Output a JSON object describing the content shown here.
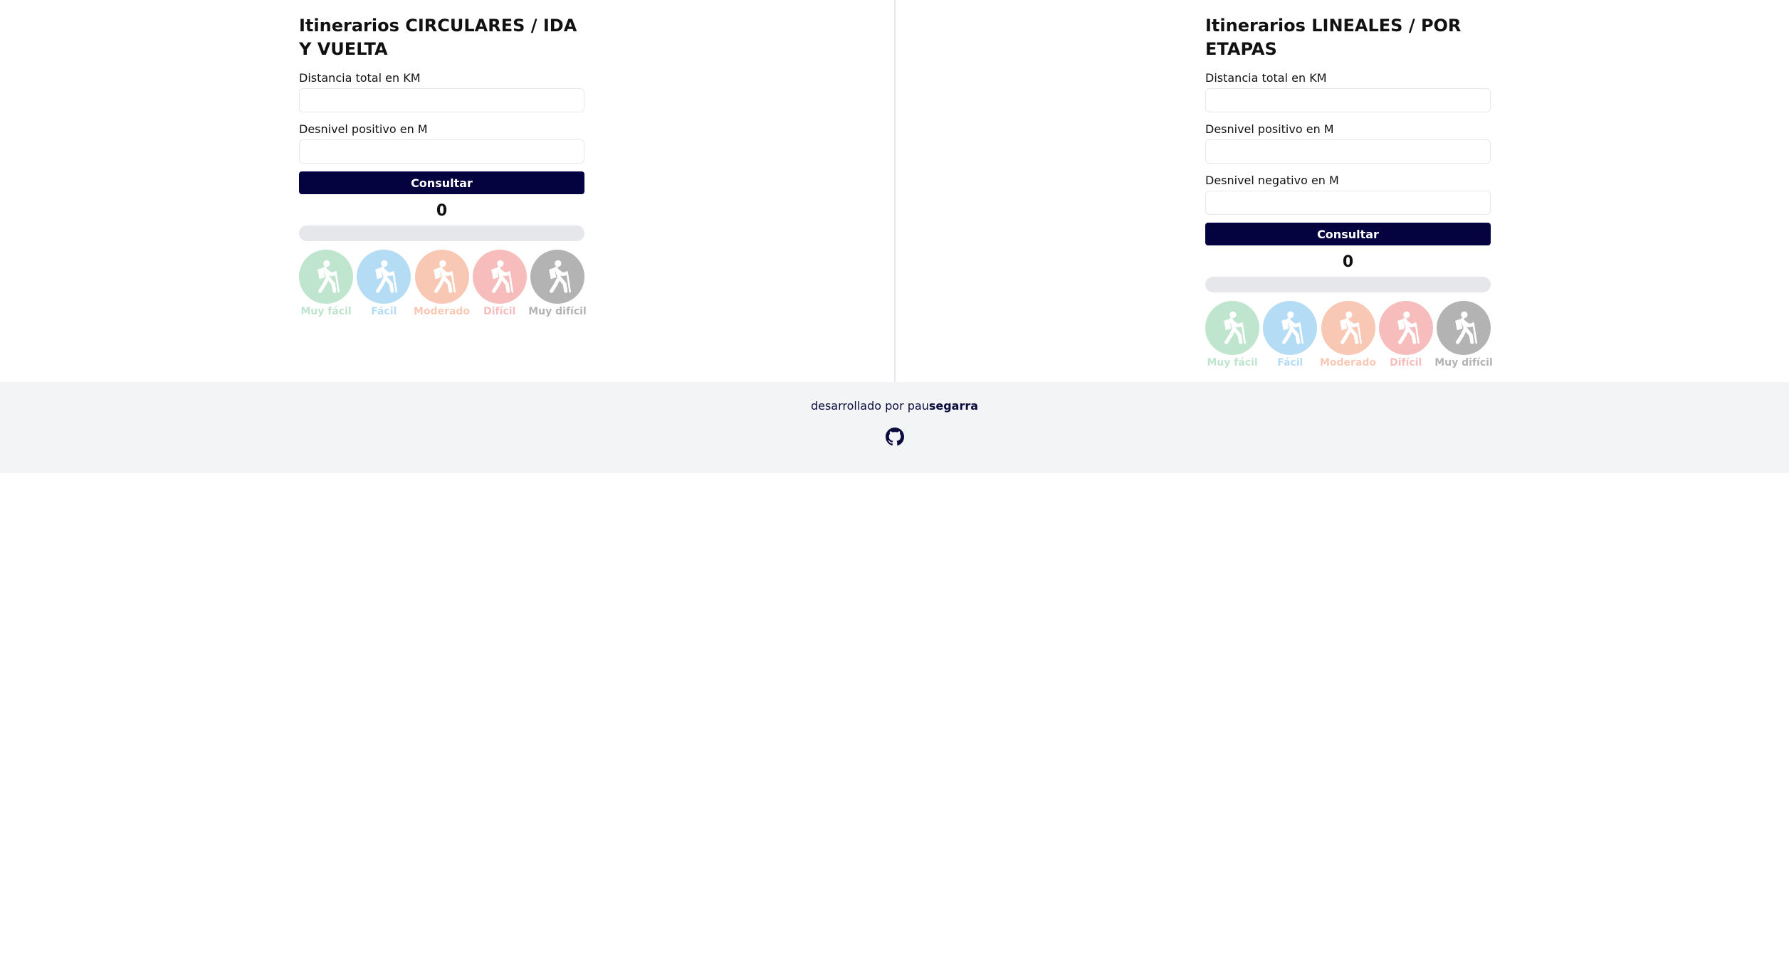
{
  "theme": {
    "primary": "#05033f",
    "primary_text": "#ffffff",
    "text": "#111111",
    "border": "#e5e7eb",
    "track": "#e5e7eb",
    "footer_bg": "#f3f4f6"
  },
  "difficulty_levels": [
    {
      "label": "Muy fácil",
      "icon": "hiker-icon",
      "color": "#bfe5cf"
    },
    {
      "label": "Fácil",
      "icon": "hiker-icon",
      "color": "#b5dcf5"
    },
    {
      "label": "Moderado",
      "icon": "hiker-icon",
      "color": "#f9c8b4"
    },
    {
      "label": "Difícil",
      "icon": "hiker-icon",
      "color": "#f7bcbc"
    },
    {
      "label": "Muy difícil",
      "icon": "hiker-icon",
      "color": "#b3b3b3"
    }
  ],
  "circular": {
    "title": "Itinerarios CIRCULARES / IDA Y VUELTA",
    "fields": [
      {
        "label": "Distancia total en KM",
        "value": "",
        "placeholder": ""
      },
      {
        "label": "Desnivel positivo en M",
        "value": "",
        "placeholder": ""
      }
    ],
    "submit_label": "Consultar",
    "score": "0",
    "progress": 0
  },
  "linear": {
    "title": "Itinerarios LINEALES / POR ETAPAS",
    "fields": [
      {
        "label": "Distancia total en KM",
        "value": "",
        "placeholder": ""
      },
      {
        "label": "Desnivel positivo en M",
        "value": "",
        "placeholder": ""
      },
      {
        "label": "Desnivel negativo en M",
        "value": "",
        "placeholder": ""
      }
    ],
    "submit_label": "Consultar",
    "score": "0",
    "progress": 0
  },
  "footer": {
    "credit_prefix": "desarrollado por pau",
    "credit_author": "segarra",
    "github_icon": "github-icon"
  }
}
